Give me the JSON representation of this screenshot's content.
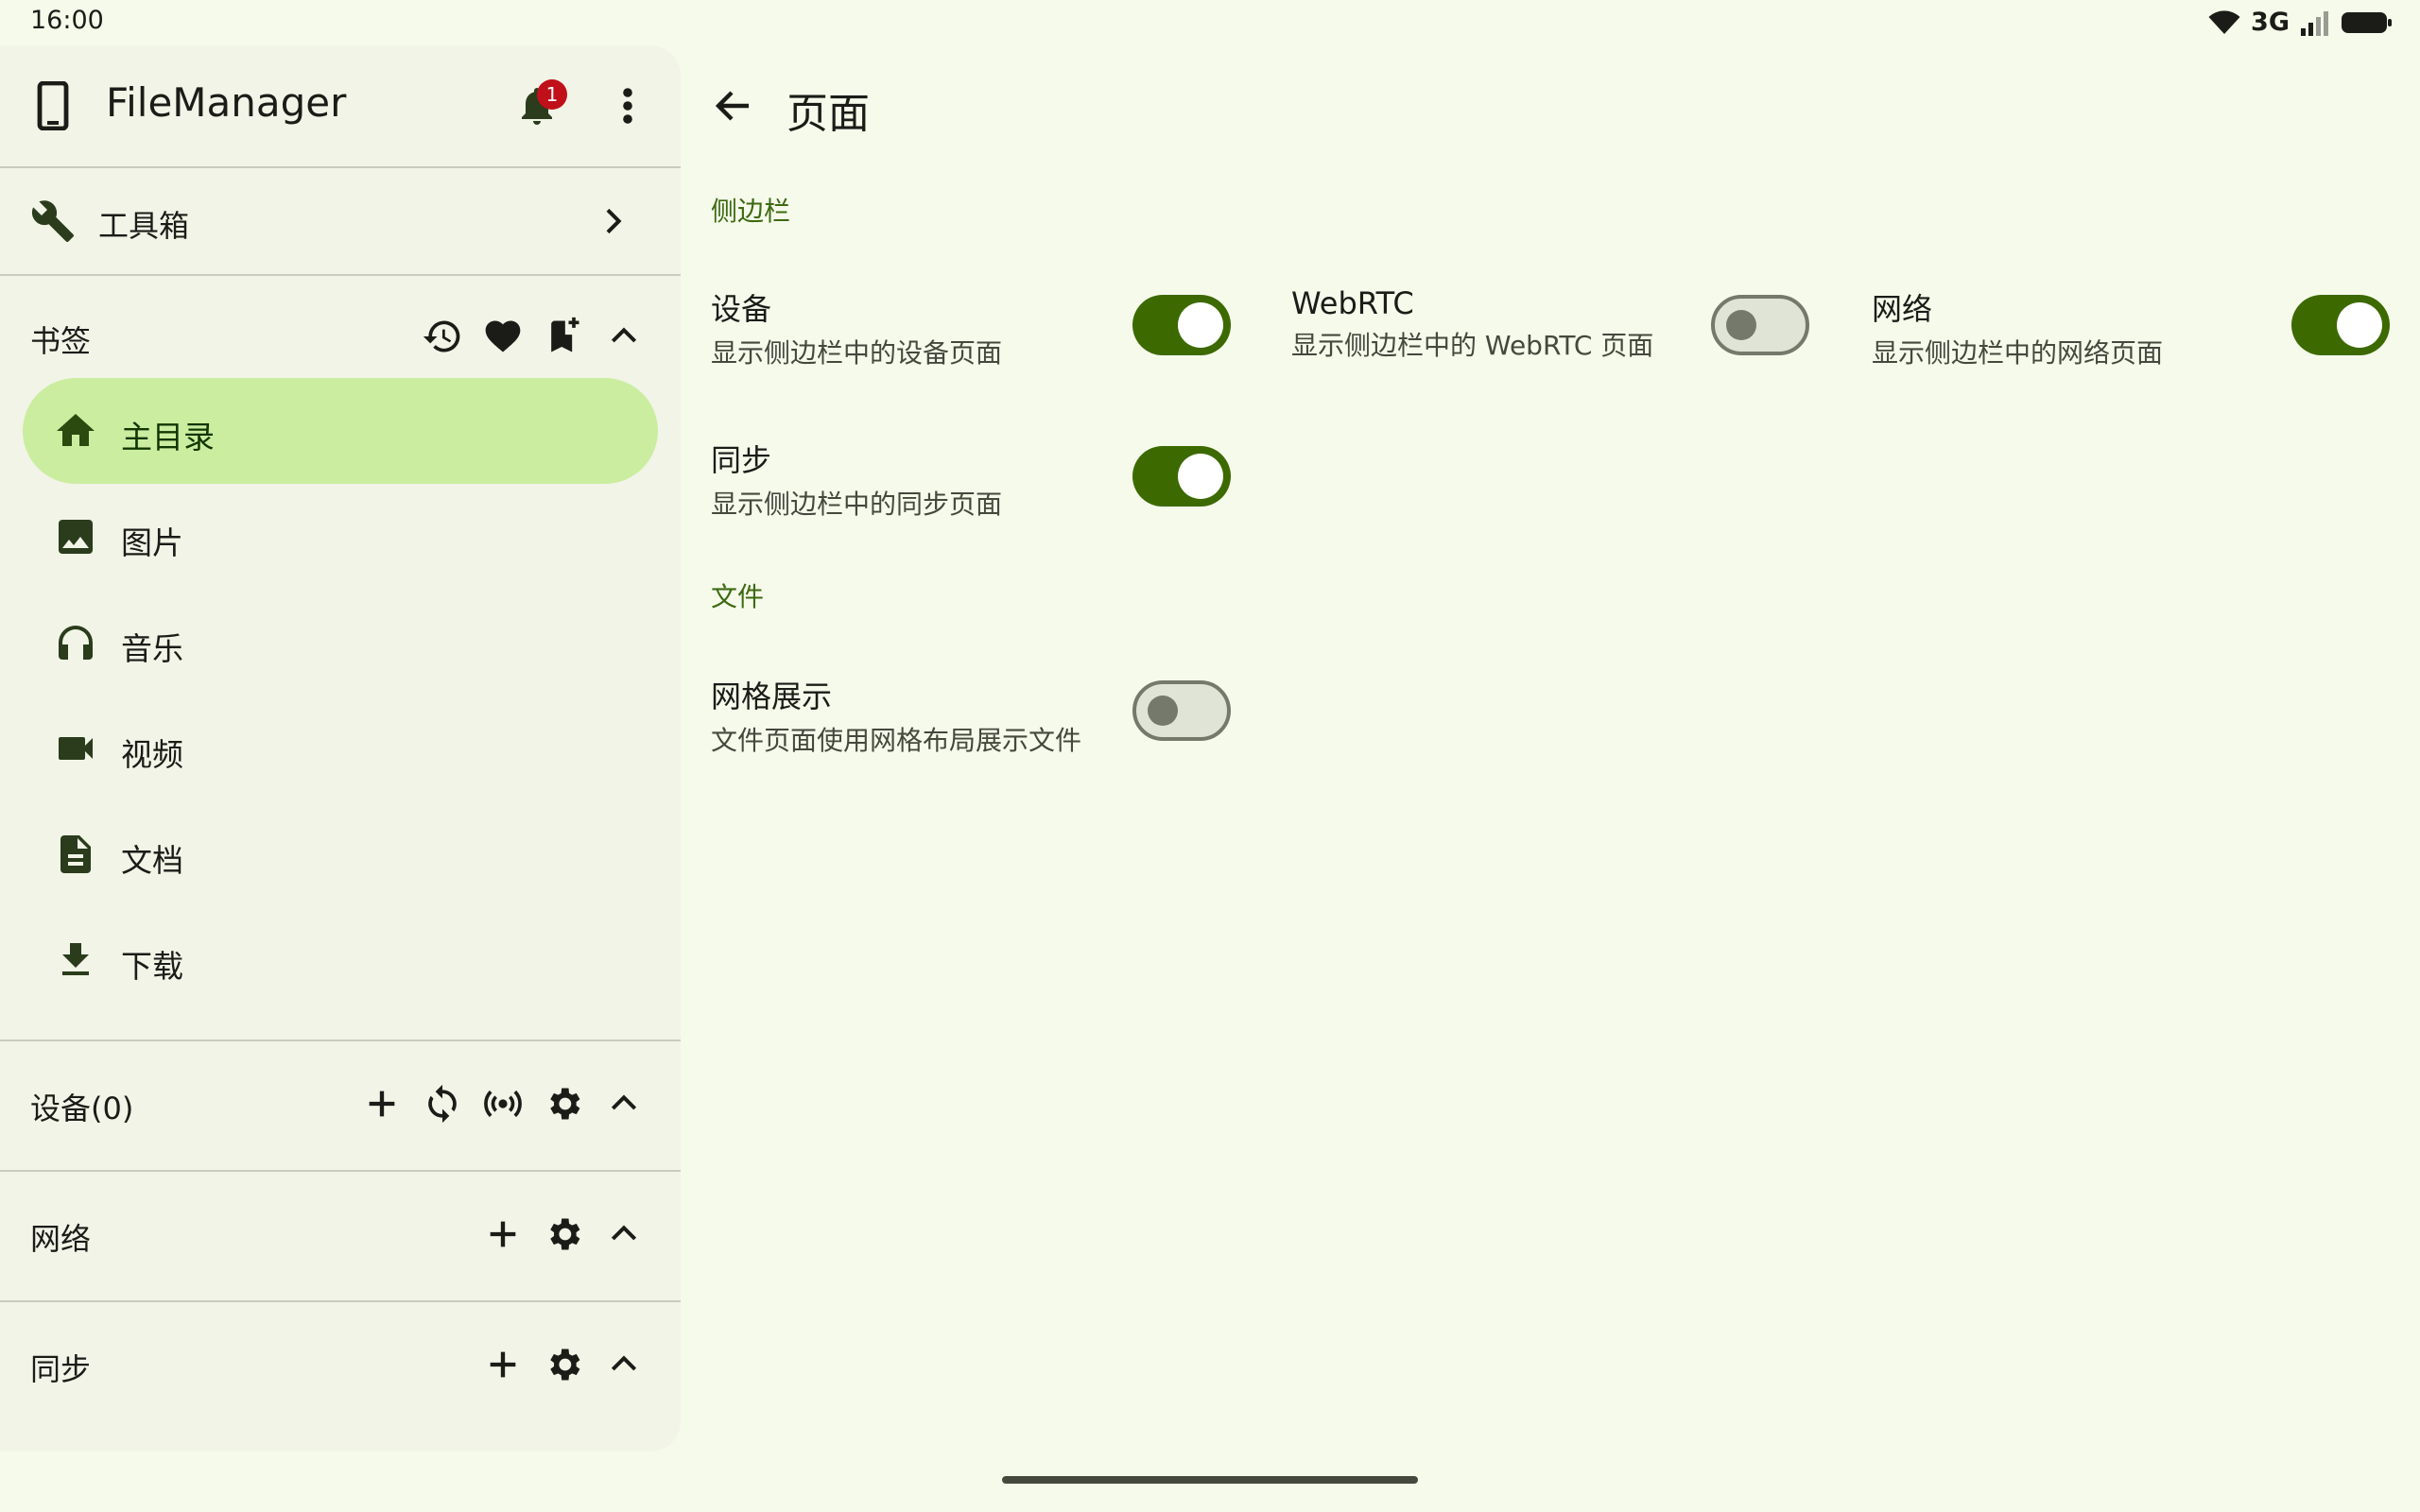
{
  "status_bar": {
    "time": "16:00",
    "network": "3G"
  },
  "sidebar": {
    "app_title": "FileManager",
    "notification_count": "1",
    "toolbox_label": "工具箱",
    "bookmarks": {
      "header": "书签",
      "items": [
        {
          "label": "主目录",
          "icon": "home-icon",
          "active": true
        },
        {
          "label": "图片",
          "icon": "image-icon"
        },
        {
          "label": "音乐",
          "icon": "headphones-icon"
        },
        {
          "label": "视频",
          "icon": "videocam-icon"
        },
        {
          "label": "文档",
          "icon": "document-icon"
        },
        {
          "label": "下载",
          "icon": "download-icon"
        }
      ]
    },
    "devices_header": "设备(0)",
    "network_header": "网络",
    "sync_header": "同步"
  },
  "main": {
    "title": "页面",
    "sections": [
      {
        "header": "侧边栏",
        "items": [
          {
            "title": "设备",
            "summary": "显示侧边栏中的设备页面",
            "enabled": true
          },
          {
            "title": "WebRTC",
            "summary": "显示侧边栏中的 WebRTC 页面",
            "enabled": false
          },
          {
            "title": "网络",
            "summary": "显示侧边栏中的网络页面",
            "enabled": true
          },
          {
            "title": "同步",
            "summary": "显示侧边栏中的同步页面",
            "enabled": true
          }
        ]
      },
      {
        "header": "文件",
        "items": [
          {
            "title": "网格展示",
            "summary": "文件页面使用网格布局展示文件",
            "enabled": false
          }
        ]
      }
    ]
  },
  "colors": {
    "background": "#f6faeb",
    "sidebar": "#f1f4e6",
    "accent": "#3c6a00",
    "active_pill": "#cbeda0",
    "badge": "#c0101a"
  }
}
